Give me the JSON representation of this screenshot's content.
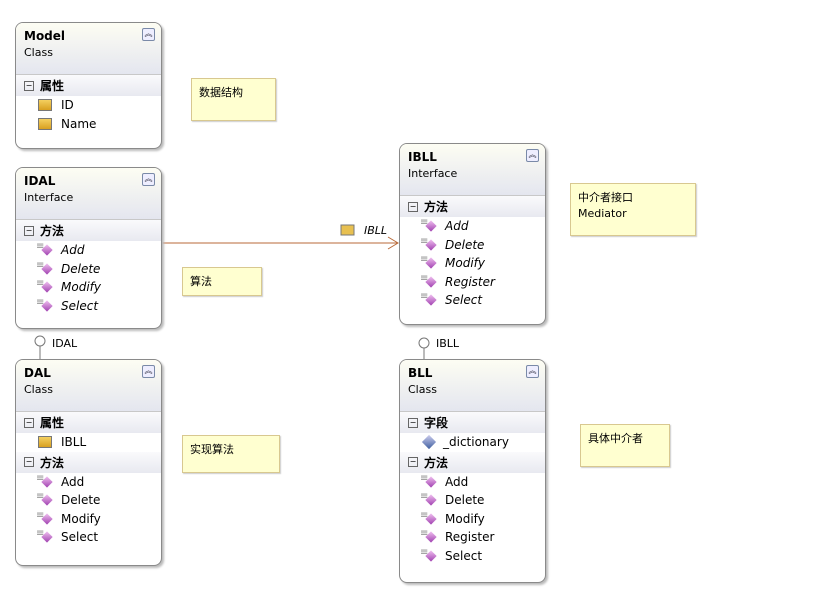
{
  "types": [
    {
      "id": "model",
      "name": "Model",
      "kind": "Class",
      "italic": false,
      "sections": [
        {
          "title": "属性",
          "icon": "property-icon",
          "items": [
            "ID",
            "Name"
          ]
        }
      ]
    },
    {
      "id": "idal",
      "name": "IDAL",
      "kind": "Interface",
      "italic": true,
      "sections": [
        {
          "title": "方法",
          "icon": "method-icon",
          "items": [
            "Add",
            "Delete",
            "Modify",
            "Select"
          ]
        }
      ]
    },
    {
      "id": "dal",
      "name": "DAL",
      "kind": "Class",
      "italic": false,
      "sections": [
        {
          "title": "属性",
          "icon": "property-icon",
          "items": [
            "IBLL"
          ]
        },
        {
          "title": "方法",
          "icon": "method-icon",
          "items": [
            "Add",
            "Delete",
            "Modify",
            "Select"
          ]
        }
      ]
    },
    {
      "id": "ibll",
      "name": "IBLL",
      "kind": "Interface",
      "italic": true,
      "sections": [
        {
          "title": "方法",
          "icon": "method-icon",
          "items": [
            "Add",
            "Delete",
            "Modify",
            "Register",
            "Select"
          ]
        }
      ]
    },
    {
      "id": "bll",
      "name": "BLL",
      "kind": "Class",
      "italic": false,
      "sections": [
        {
          "title": "字段",
          "icon": "field-icon",
          "items": [
            "_dictionary"
          ]
        },
        {
          "title": "方法",
          "icon": "method-icon",
          "items": [
            "Add",
            "Delete",
            "Modify",
            "Register",
            "Select"
          ]
        }
      ]
    }
  ],
  "notes": {
    "model": "数据结构",
    "idal": "算法",
    "dal": "实现算法",
    "ibll": "中介者接口\nMediator",
    "bll": "具体中介者"
  },
  "association": {
    "label": "IBLL"
  },
  "lollipops": {
    "idal": "IDAL",
    "ibll": "IBLL"
  }
}
